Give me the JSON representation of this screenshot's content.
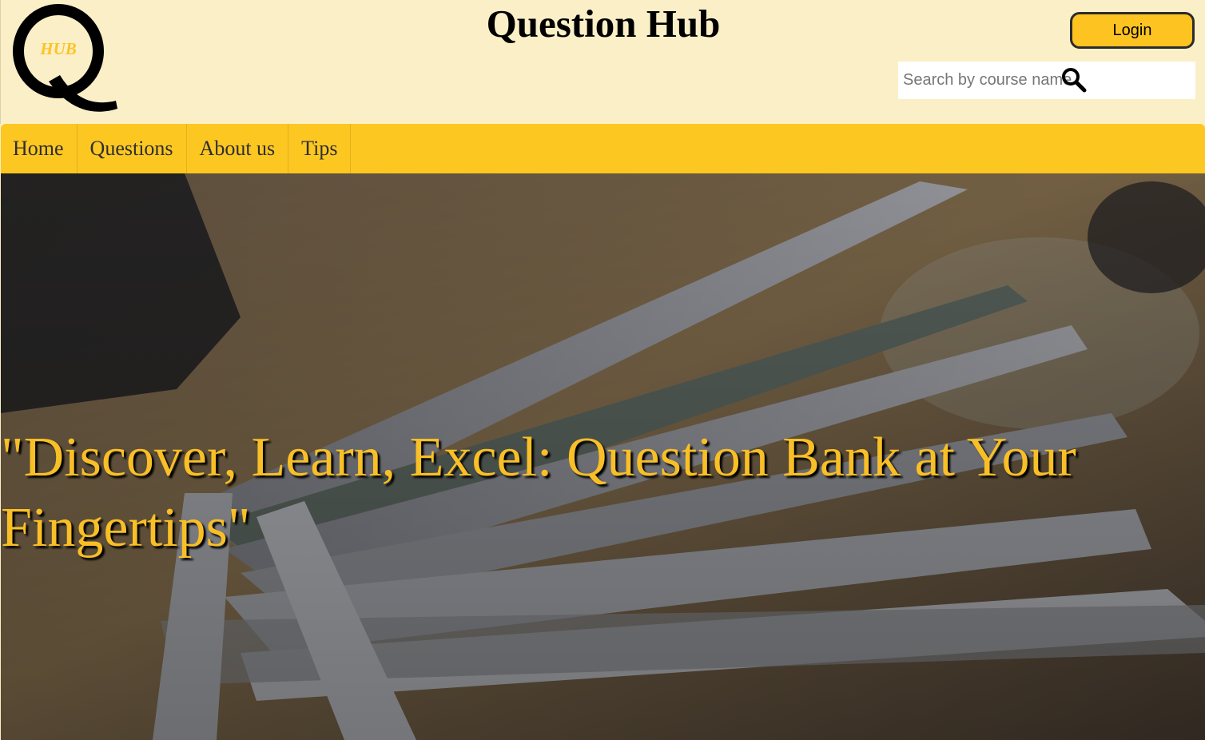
{
  "header": {
    "logo_letter": "Q",
    "logo_sub": "HUB",
    "title": "Question Hub",
    "login_label": "Login"
  },
  "search": {
    "placeholder": "Search by course name",
    "icon": "search-icon"
  },
  "nav": {
    "items": [
      {
        "label": "Home"
      },
      {
        "label": "Questions"
      },
      {
        "label": "About us"
      },
      {
        "label": "Tips"
      }
    ]
  },
  "hero": {
    "tagline": "\"Discover, Learn, Excel: Question Bank at Your Fingertips\""
  },
  "colors": {
    "header_bg": "#faefc7",
    "accent": "#fdc722",
    "tagline": "#f9bf26"
  }
}
